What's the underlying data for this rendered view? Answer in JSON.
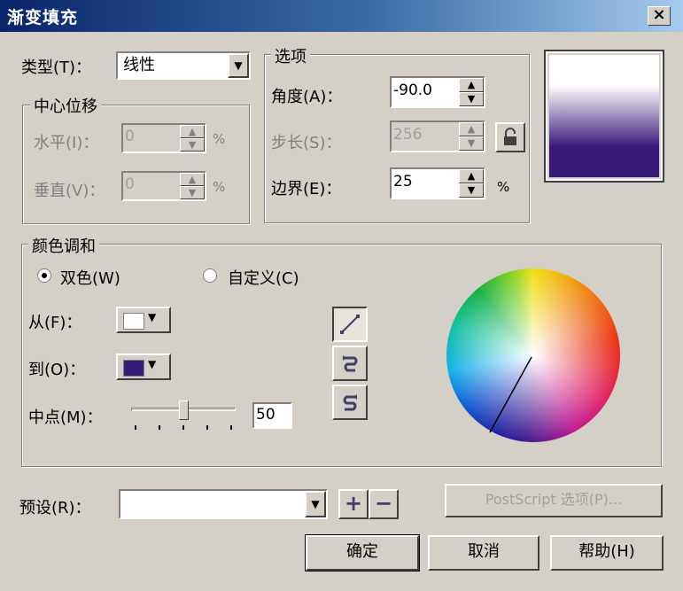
{
  "window": {
    "title": "渐变填充",
    "close_glyph": "×"
  },
  "type": {
    "label": "类型(T)：",
    "value": "线性"
  },
  "center_offset": {
    "legend": "中心位移",
    "horizontal": {
      "label": "水平(I)：",
      "value": "0",
      "unit": "%"
    },
    "vertical": {
      "label": "垂直(V)：",
      "value": "0",
      "unit": "%"
    }
  },
  "options": {
    "legend": "选项",
    "angle": {
      "label": "角度(A)：",
      "value": "-90.0"
    },
    "steps": {
      "label": "步长(S)：",
      "value": "256"
    },
    "edge": {
      "label": "边界(E)：",
      "value": "25",
      "unit": "%"
    }
  },
  "preview": {
    "top_color": "#ffffff",
    "bottom_color": "#3a1a78"
  },
  "color_blend": {
    "legend": "颜色调和",
    "two_color": {
      "label": "双色(W)",
      "selected": true
    },
    "custom": {
      "label": "自定义(C)",
      "selected": false
    },
    "from": {
      "label": "从(F)：",
      "color": "#ffffff"
    },
    "to": {
      "label": "到(O)：",
      "color": "#3a1a78"
    },
    "midpoint": {
      "label": "中点(M)：",
      "value": "50",
      "fraction": 0.5
    }
  },
  "presets": {
    "label": "预设(R)：",
    "value": "",
    "add_glyph": "+",
    "remove_glyph": "−"
  },
  "buttons": {
    "postscript": "PostScript 选项(P)...",
    "ok": "确定",
    "cancel": "取消",
    "help": "帮助(H)"
  },
  "icons": [
    "lock-icon",
    "linear-blend-icon",
    "counterclockwise-blend-icon",
    "clockwise-blend-icon",
    "dropdown-arrow-icon",
    "spin-up-icon",
    "spin-down-icon"
  ]
}
